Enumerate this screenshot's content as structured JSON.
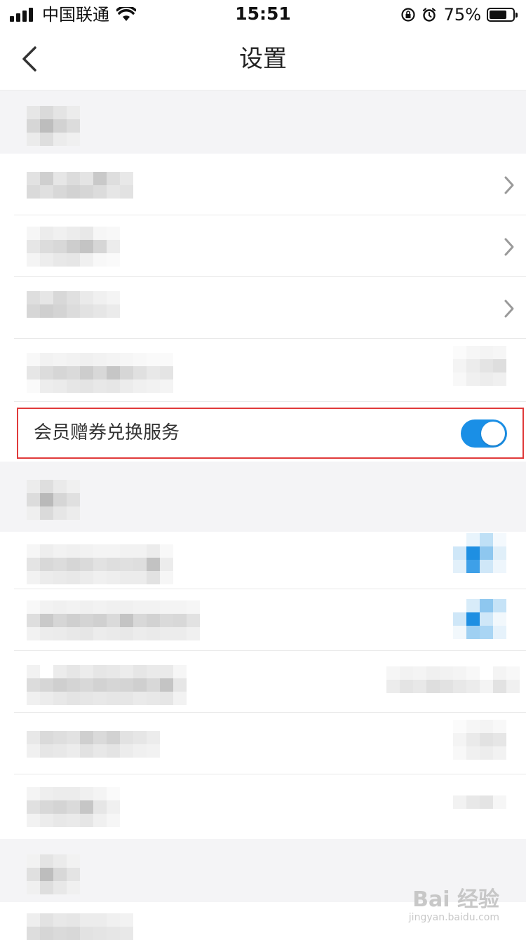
{
  "status_bar": {
    "carrier": "中国联通",
    "time": "15:51",
    "battery_percent": "75%",
    "battery_level": 0.75,
    "icons": [
      "signal-icon",
      "wifi-icon",
      "orientation-lock-icon",
      "alarm-icon",
      "battery-icon"
    ]
  },
  "nav": {
    "title": "设置",
    "back_icon": "chevron-left-icon"
  },
  "highlight": {
    "label": "会员赠券兑换服务",
    "toggle_on": true,
    "toggle_color": "#1a8fe6",
    "border_color": "#e03a3a"
  },
  "watermark": {
    "main": "Bai 经验",
    "sub": "jingyan.baidu.com"
  },
  "colors": {
    "section_bg": "#f4f4f6",
    "divider": "#e9e9e9",
    "accent_blue": "#1a8fe6"
  }
}
